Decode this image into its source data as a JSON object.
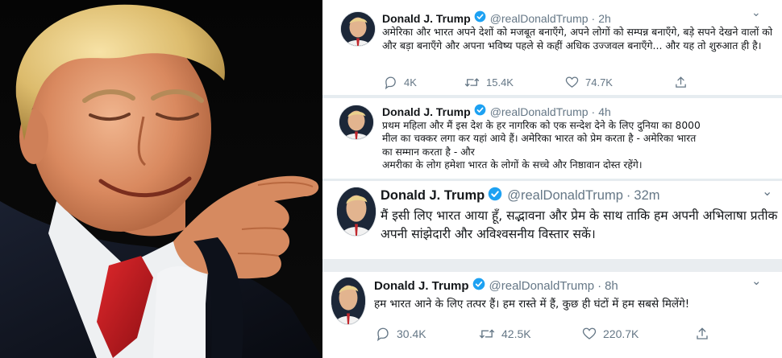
{
  "photo": {
    "subject": "photo"
  },
  "tweets": [
    {
      "name": "Donald J. Trump",
      "handle": "@realDonaldTrump",
      "time": "2h",
      "text": "अमेरिका और भारत अपने देशों को मजबूत बनाएँगे,  अपने लोगों को सम्पन्न बनाएँगे, बड़े सपने देखने वालों को और बड़ा बनाएँगे और अपना भविष्य पहले से कहीं अधिक उज्जवल बनाएँगे... और यह तो शुरुआत ही है।",
      "replies": "4K",
      "retweets": "15.4K",
      "likes": "74.7K"
    },
    {
      "name": "Donald J. Trump",
      "handle": "@realDonaldTrump",
      "time": "4h",
      "text_lines": [
        "प्रथम महिला और मैं इस देश के हर नागरिक को एक सन्देश देने के लिए दुनिया का 8000",
        "मील का चक्कर लगा कर यहां आये हैं। अमेरिका भारत को  प्रेम करता है - अमेरिका भारत",
        "का सम्मान करता है - और",
        "अमरीका के लोग हमेशा भारत के लोगों के सच्चे और निष्ठावान दोस्त रहेंगे।"
      ]
    },
    {
      "name": "Donald J. Trump",
      "handle": "@realDonaldTrump",
      "time": "32m",
      "text": "मैं इसी लिए भारत आया हूँ, सद्भावना और प्रेम के साथ ताकि हम अपनी अभिलाषा प्रतीक अपनी सांझेदारी और अविश्वसनीय विस्तार सकें।"
    },
    {
      "name": "Donald J. Trump",
      "handle": "@realDonaldTrump",
      "time": "8h",
      "text": "हम भारत आने के लिए तत्पर हैं। हम रास्ते में हैं, कुछ ही घंटों में हम सबसे मिलेंगे!",
      "replies": "30.4K",
      "retweets": "42.5K",
      "likes": "220.7K"
    }
  ],
  "separator": "·",
  "caret": "⌄",
  "colors": {
    "verified": "#1da1f2",
    "muted": "#657786",
    "text": "#14171a",
    "divider": "#e6ecf0"
  },
  "icons": [
    "verified-badge-icon",
    "reply-icon",
    "retweet-icon",
    "like-icon",
    "share-icon",
    "chevron-down-icon"
  ]
}
